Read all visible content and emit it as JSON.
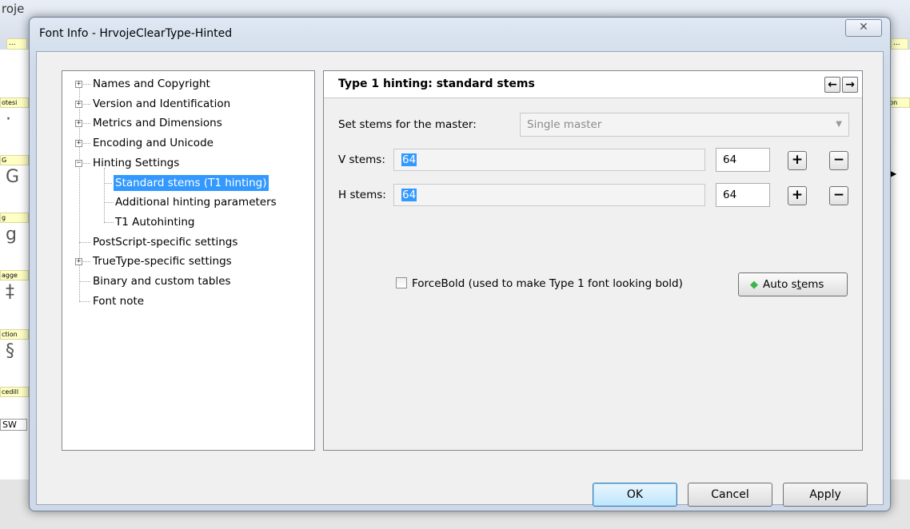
{
  "background_app": {
    "title_fragment": "roje",
    "strip_label": "...",
    "left_column": [
      {
        "label": "otesi",
        "glyph": "·"
      },
      {
        "label": "G",
        "glyph": "G"
      },
      {
        "label": "g",
        "glyph": "g"
      },
      {
        "label": "agge",
        "glyph": "‡"
      },
      {
        "label": "ction",
        "glyph": "§"
      },
      {
        "label": "cedill",
        "glyph": ""
      }
    ],
    "left_tab": "SW",
    "right_label": "lon",
    "right_strip": "..."
  },
  "dialog": {
    "title": "Font Info - HrvojeClearType-Hinted",
    "close_glyph": "✕"
  },
  "tree": {
    "items": [
      {
        "label": "Names and Copyright",
        "expander": "+"
      },
      {
        "label": "Version and Identification",
        "expander": "+"
      },
      {
        "label": "Metrics and Dimensions",
        "expander": "+"
      },
      {
        "label": "Encoding and Unicode",
        "expander": "+"
      },
      {
        "label": "Hinting Settings",
        "expander": "−"
      },
      {
        "label": "Standard stems (T1 hinting)",
        "expander": ""
      },
      {
        "label": "Additional hinting parameters",
        "expander": ""
      },
      {
        "label": "T1 Autohinting",
        "expander": ""
      },
      {
        "label": "PostScript-specific settings",
        "expander": ""
      },
      {
        "label": "TrueType-specific settings",
        "expander": "+"
      },
      {
        "label": "Binary and custom tables",
        "expander": ""
      },
      {
        "label": "Font note",
        "expander": ""
      }
    ],
    "selected_index": 5
  },
  "panel": {
    "title": "Type 1 hinting: standard stems",
    "back_glyph": "←",
    "forward_glyph": "→",
    "master_label": "Set stems for the master:",
    "master_value": "Single master",
    "combo_arrow": "▼",
    "v_stems_label": "V stems:",
    "v_stems_value": "64",
    "v_stems_number": "64",
    "h_stems_label": "H stems:",
    "h_stems_value": "64",
    "h_stems_number": "64",
    "plus_glyph": "+",
    "minus_glyph": "−",
    "force_bold_label": "ForceBold (used to make Type 1 font looking bold)",
    "force_bold_checked": false,
    "auto_stems_label_prefix": "Auto s",
    "auto_stems_label_accel": "t",
    "auto_stems_label_suffix": "ems",
    "auto_stems_icon": "diamond-icon"
  },
  "buttons": {
    "ok": "OK",
    "cancel": "Cancel",
    "apply": "Apply"
  }
}
